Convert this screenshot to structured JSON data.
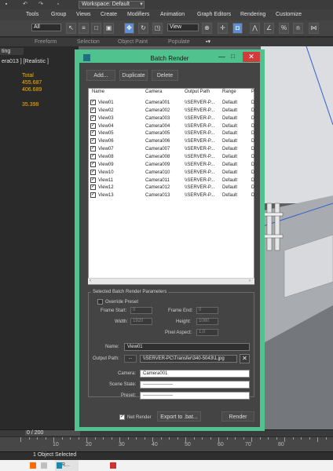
{
  "app": {
    "workspace": "Workspace: Default"
  },
  "menu": [
    "Tools",
    "Group",
    "Views",
    "Create",
    "Modifiers",
    "Animation",
    "Graph Editors",
    "Rendering",
    "Customize"
  ],
  "toolbar": {
    "selection_filter": "All",
    "ref_coord": "View"
  },
  "ribbon": [
    "Freeform",
    "Selection",
    "Object Paint",
    "Populate"
  ],
  "left": {
    "tab": "ting",
    "viewport_label": "era013 ] [Realistic ]",
    "stats": [
      "Total",
      "455.687",
      "406.689",
      "35.398"
    ]
  },
  "dialog": {
    "title": "Batch Render",
    "buttons": {
      "add": "Add...",
      "duplicate": "Duplicate",
      "delete": "Delete"
    },
    "columns": [
      "Name",
      "Camera",
      "Output Path",
      "Range",
      "P"
    ],
    "rows": [
      {
        "name": "View01",
        "camera": "Camera001",
        "path": "\\\\SERVER-P...",
        "range": "Default",
        "p": "D"
      },
      {
        "name": "View02",
        "camera": "Camera002",
        "path": "\\\\SERVER-P...",
        "range": "Default",
        "p": "D"
      },
      {
        "name": "View03",
        "camera": "Camera003",
        "path": "\\\\SERVER-P...",
        "range": "Default",
        "p": "D"
      },
      {
        "name": "View04",
        "camera": "Camera004",
        "path": "\\\\SERVER-P...",
        "range": "Default",
        "p": "D"
      },
      {
        "name": "View05",
        "camera": "Camera005",
        "path": "\\\\SERVER-P...",
        "range": "Default",
        "p": "D"
      },
      {
        "name": "View06",
        "camera": "Camera006",
        "path": "\\\\SERVER-P...",
        "range": "Default",
        "p": "D"
      },
      {
        "name": "View07",
        "camera": "Camera007",
        "path": "\\\\SERVER-P...",
        "range": "Default",
        "p": "D"
      },
      {
        "name": "View08",
        "camera": "Camera008",
        "path": "\\\\SERVER-P...",
        "range": "Default",
        "p": "D"
      },
      {
        "name": "View09",
        "camera": "Camera009",
        "path": "\\\\SERVER-P...",
        "range": "Default",
        "p": "D"
      },
      {
        "name": "View10",
        "camera": "Camera010",
        "path": "\\\\SERVER-P...",
        "range": "Default",
        "p": "D"
      },
      {
        "name": "View11",
        "camera": "Camera011",
        "path": "\\\\SERVER-P...",
        "range": "Default",
        "p": "D"
      },
      {
        "name": "View12",
        "camera": "Camera012",
        "path": "\\\\SERVER-P...",
        "range": "Default",
        "p": "D"
      },
      {
        "name": "View13",
        "camera": "Camera013",
        "path": "\\\\SERVER-P...",
        "range": "Default",
        "p": "D"
      }
    ],
    "params": {
      "group": "Selected Batch Render Parameters",
      "override": "Override Preset",
      "frame_start_label": "Frame Start:",
      "frame_start": "0",
      "frame_end_label": "Frame End:",
      "frame_end": "0",
      "width_label": "Width:",
      "width": "1920",
      "height_label": "Height:",
      "height": "1080",
      "pixel_aspect_label": "Pixel Aspect:",
      "pixel_aspect": "1,0",
      "name_label": "Name:",
      "name": "View01",
      "output_label": "Output Path:",
      "output_browse": "...",
      "output_path": "\\\\SERVER-PC\\Transfer\\340-5043\\1.jpg",
      "camera_label": "Camera:",
      "camera": "Camera001",
      "scene_state_label": "Scene State:",
      "scene_state": "-------------------",
      "preset_label": "Preset:",
      "preset": "-------------------"
    },
    "footer": {
      "net_render": "Net Render",
      "export": "Export to .bat...",
      "render": "Render"
    }
  },
  "timeline": {
    "position": "0 / 200",
    "ticks": [
      "10",
      "20",
      "30",
      "40",
      "50",
      "60",
      "70",
      "80"
    ]
  },
  "status": {
    "text": "1 Object Selected"
  },
  "taskbar": {
    "app": "R..."
  }
}
